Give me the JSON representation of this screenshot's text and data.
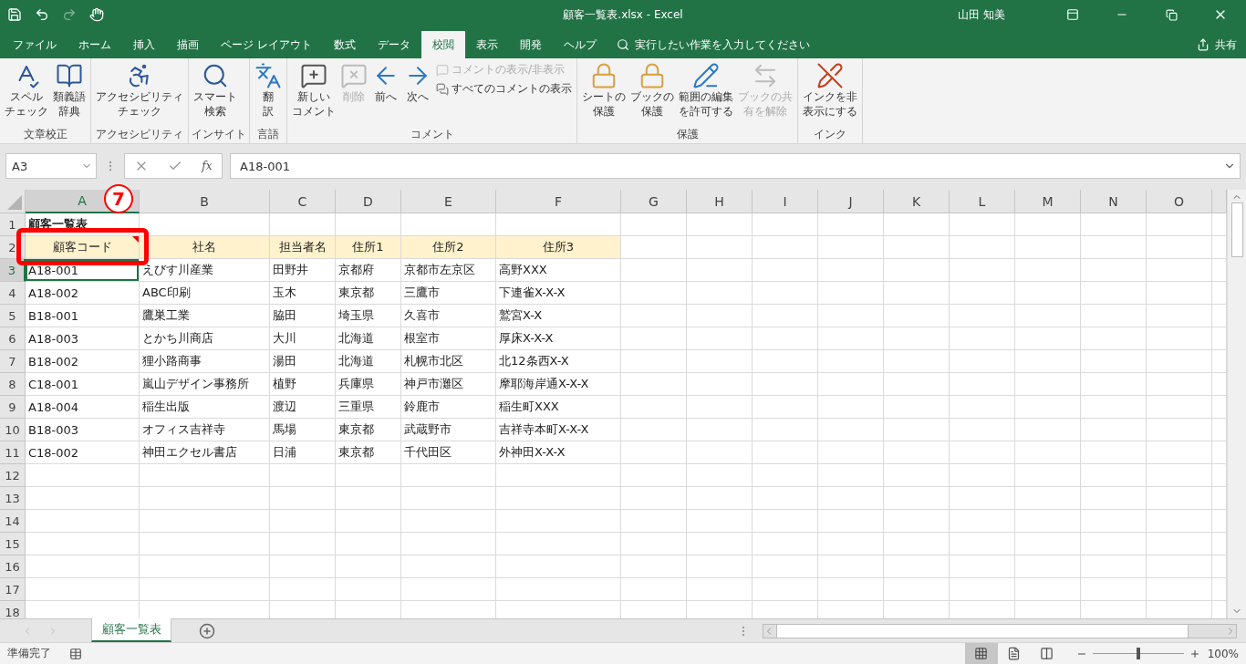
{
  "window": {
    "title": "顧客一覧表.xlsx  -  Excel",
    "user": "山田 知美"
  },
  "quick_access": [
    {
      "disabled": false
    },
    {
      "disabled": false
    },
    {
      "disabled": true
    },
    {
      "disabled": false
    }
  ],
  "tabs": [
    {
      "label": "ファイル",
      "selected": false
    },
    {
      "label": "ホーム",
      "selected": false
    },
    {
      "label": "挿入",
      "selected": false
    },
    {
      "label": "描画",
      "selected": false
    },
    {
      "label": "ページ レイアウト",
      "selected": false
    },
    {
      "label": "数式",
      "selected": false
    },
    {
      "label": "データ",
      "selected": false
    },
    {
      "label": "校閲",
      "selected": true
    },
    {
      "label": "表示",
      "selected": false
    },
    {
      "label": "開発",
      "selected": false
    },
    {
      "label": "ヘルプ",
      "selected": false
    }
  ],
  "tell_me": {
    "placeholder": "実行したい作業を入力してください"
  },
  "share": {
    "label": "共有"
  },
  "ribbon": [
    {
      "label": "文章校正",
      "buttons": [
        {
          "kind": "large",
          "lines": [
            "スペル",
            "チェック"
          ],
          "disabled": false
        },
        {
          "kind": "large",
          "lines": [
            "類義語",
            "辞典"
          ],
          "disabled": false
        }
      ]
    },
    {
      "label": "アクセシビリティ",
      "buttons": [
        {
          "kind": "large",
          "lines": [
            "アクセシビリティ",
            "チェック"
          ],
          "disabled": false
        }
      ]
    },
    {
      "label": "インサイト",
      "buttons": [
        {
          "kind": "large",
          "lines": [
            "スマート",
            "検索"
          ],
          "disabled": false
        }
      ]
    },
    {
      "label": "言語",
      "buttons": [
        {
          "kind": "large",
          "lines": [
            "翻",
            "訳"
          ],
          "disabled": false
        }
      ]
    },
    {
      "label": "コメント",
      "buttons": [
        {
          "kind": "large",
          "lines": [
            "新しい",
            "コメント"
          ],
          "disabled": false
        },
        {
          "kind": "large",
          "lines": [
            "削除"
          ],
          "disabled": true
        },
        {
          "kind": "large",
          "lines": [
            "前へ"
          ],
          "disabled": false
        },
        {
          "kind": "large",
          "lines": [
            "次へ"
          ],
          "disabled": false
        },
        {
          "kind": "small",
          "lines": [
            "コメントの表示/非表示"
          ],
          "disabled": true
        },
        {
          "kind": "small",
          "lines": [
            "すべてのコメントの表示"
          ],
          "disabled": false
        }
      ]
    },
    {
      "label": "保護",
      "buttons": [
        {
          "kind": "large",
          "lines": [
            "シートの",
            "保護"
          ],
          "disabled": false
        },
        {
          "kind": "large",
          "lines": [
            "ブックの",
            "保護"
          ],
          "disabled": false
        },
        {
          "kind": "large",
          "lines": [
            "範囲の編集",
            "を許可する"
          ],
          "disabled": false
        },
        {
          "kind": "large",
          "lines": [
            "ブックの共",
            "有を解除"
          ],
          "disabled": true
        }
      ]
    },
    {
      "label": "インク",
      "buttons": [
        {
          "kind": "large",
          "lines": [
            "インクを非",
            "表示にする"
          ],
          "disabled": false
        }
      ]
    }
  ],
  "formula_bar": {
    "name_box": "A3",
    "function_label": "fx",
    "value": "A18-001"
  },
  "sheet": {
    "columns": [
      {
        "label": "A",
        "selected": true
      },
      {
        "label": "B",
        "selected": false
      },
      {
        "label": "C",
        "selected": false
      },
      {
        "label": "D",
        "selected": false
      },
      {
        "label": "E",
        "selected": false
      },
      {
        "label": "F",
        "selected": false
      },
      {
        "label": "G",
        "selected": false
      },
      {
        "label": "H",
        "selected": false
      },
      {
        "label": "I",
        "selected": false
      },
      {
        "label": "J",
        "selected": false
      },
      {
        "label": "K",
        "selected": false
      },
      {
        "label": "L",
        "selected": false
      },
      {
        "label": "M",
        "selected": false
      },
      {
        "label": "N",
        "selected": false
      },
      {
        "label": "O",
        "selected": false
      }
    ],
    "rows": [
      {
        "number": "1",
        "kind": "title",
        "selected": false,
        "cells": [
          {
            "text": "顧客一覧表",
            "comment": false
          }
        ]
      },
      {
        "number": "2",
        "kind": "header",
        "selected": false,
        "cells": [
          {
            "text": "顧客コード",
            "comment": true
          },
          {
            "text": "社名",
            "comment": false
          },
          {
            "text": "担当者名",
            "comment": false
          },
          {
            "text": "住所1",
            "comment": false
          },
          {
            "text": "住所2",
            "comment": false
          },
          {
            "text": "住所3",
            "comment": false
          }
        ]
      },
      {
        "number": "3",
        "kind": "data",
        "selected": true,
        "cells": [
          {
            "text": "A18-001",
            "comment": false
          },
          {
            "text": "えびす川産業",
            "comment": false
          },
          {
            "text": "田野井",
            "comment": false
          },
          {
            "text": "京都府",
            "comment": false
          },
          {
            "text": "京都市左京区",
            "comment": false
          },
          {
            "text": "高野XXX",
            "comment": false
          }
        ]
      },
      {
        "number": "4",
        "kind": "data",
        "selected": false,
        "cells": [
          {
            "text": "A18-002",
            "comment": false
          },
          {
            "text": "ABC印刷",
            "comment": false
          },
          {
            "text": "玉木",
            "comment": false
          },
          {
            "text": "東京都",
            "comment": false
          },
          {
            "text": "三鷹市",
            "comment": false
          },
          {
            "text": "下連雀X-X-X",
            "comment": false
          }
        ]
      },
      {
        "number": "5",
        "kind": "data",
        "selected": false,
        "cells": [
          {
            "text": "B18-001",
            "comment": false
          },
          {
            "text": "鷹巣工業",
            "comment": false
          },
          {
            "text": "脇田",
            "comment": false
          },
          {
            "text": "埼玉県",
            "comment": false
          },
          {
            "text": "久喜市",
            "comment": false
          },
          {
            "text": "鷲宮X-X",
            "comment": false
          }
        ]
      },
      {
        "number": "6",
        "kind": "data",
        "selected": false,
        "cells": [
          {
            "text": "A18-003",
            "comment": false
          },
          {
            "text": "とかち川商店",
            "comment": false
          },
          {
            "text": "大川",
            "comment": false
          },
          {
            "text": "北海道",
            "comment": false
          },
          {
            "text": "根室市",
            "comment": false
          },
          {
            "text": "厚床X-X-X",
            "comment": false
          }
        ]
      },
      {
        "number": "7",
        "kind": "data",
        "selected": false,
        "cells": [
          {
            "text": "B18-002",
            "comment": false
          },
          {
            "text": "狸小路商事",
            "comment": false
          },
          {
            "text": "湯田",
            "comment": false
          },
          {
            "text": "北海道",
            "comment": false
          },
          {
            "text": "札幌市北区",
            "comment": false
          },
          {
            "text": "北12条西X-X",
            "comment": false
          }
        ]
      },
      {
        "number": "8",
        "kind": "data",
        "selected": false,
        "cells": [
          {
            "text": "C18-001",
            "comment": false
          },
          {
            "text": "嵐山デザイン事務所",
            "comment": false
          },
          {
            "text": "植野",
            "comment": false
          },
          {
            "text": "兵庫県",
            "comment": false
          },
          {
            "text": "神戸市灘区",
            "comment": false
          },
          {
            "text": "摩耶海岸通X-X-X",
            "comment": false
          }
        ]
      },
      {
        "number": "9",
        "kind": "data",
        "selected": false,
        "cells": [
          {
            "text": "A18-004",
            "comment": false
          },
          {
            "text": "稲生出版",
            "comment": false
          },
          {
            "text": "渡辺",
            "comment": false
          },
          {
            "text": "三重県",
            "comment": false
          },
          {
            "text": "鈴鹿市",
            "comment": false
          },
          {
            "text": "稲生町XXX",
            "comment": false
          }
        ]
      },
      {
        "number": "10",
        "kind": "data",
        "selected": false,
        "cells": [
          {
            "text": "B18-003",
            "comment": false
          },
          {
            "text": "オフィス吉祥寺",
            "comment": false
          },
          {
            "text": "馬場",
            "comment": false
          },
          {
            "text": "東京都",
            "comment": false
          },
          {
            "text": "武蔵野市",
            "comment": false
          },
          {
            "text": "吉祥寺本町X-X-X",
            "comment": false
          }
        ]
      },
      {
        "number": "11",
        "kind": "data",
        "selected": false,
        "cells": [
          {
            "text": "C18-002",
            "comment": false
          },
          {
            "text": "神田エクセル書店",
            "comment": false
          },
          {
            "text": "日浦",
            "comment": false
          },
          {
            "text": "東京都",
            "comment": false
          },
          {
            "text": "千代田区",
            "comment": false
          },
          {
            "text": "外神田X-X-X",
            "comment": false
          }
        ]
      },
      {
        "number": "12",
        "kind": "data",
        "selected": false,
        "cells": []
      },
      {
        "number": "13",
        "kind": "data",
        "selected": false,
        "cells": []
      },
      {
        "number": "14",
        "kind": "data",
        "selected": false,
        "cells": []
      },
      {
        "number": "15",
        "kind": "data",
        "selected": false,
        "cells": []
      },
      {
        "number": "16",
        "kind": "data",
        "selected": false,
        "cells": []
      },
      {
        "number": "17",
        "kind": "data",
        "selected": false,
        "cells": []
      },
      {
        "number": "18",
        "kind": "data",
        "selected": false,
        "cells": []
      }
    ]
  },
  "callout": {
    "number": "7"
  },
  "sheet_tabs": [
    {
      "label": "顧客一覧表",
      "selected": true
    }
  ],
  "status_bar": {
    "text": "準備完了",
    "views": [
      {
        "selected": true
      },
      {
        "selected": false
      },
      {
        "selected": false
      }
    ],
    "zoom": {
      "level": 0.5,
      "reading": "100%"
    }
  }
}
